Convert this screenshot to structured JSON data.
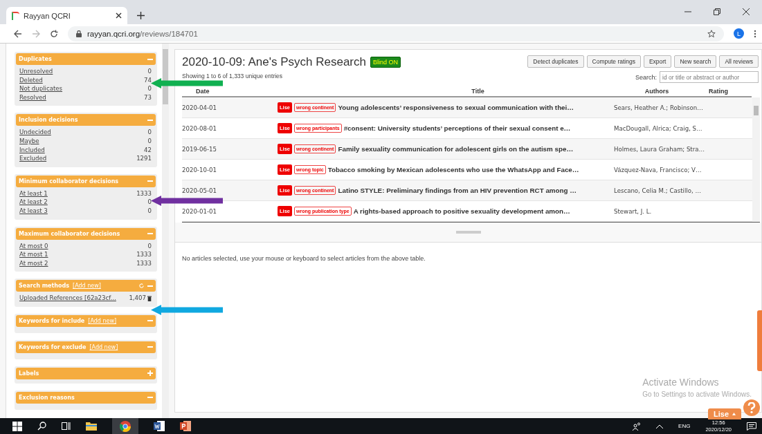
{
  "browser": {
    "tab_title": "Rayyan QCRI",
    "url_host": "rayyan.qcri.org",
    "url_path": "/reviews/184701",
    "profile": "L"
  },
  "sidebar": {
    "panels": [
      {
        "title": "Duplicates",
        "refreshable": false,
        "expanded": true,
        "items": [
          {
            "kind": "filter",
            "label": "Unresolved",
            "count": "0"
          },
          {
            "kind": "filter",
            "label": "Deleted",
            "count": "74"
          },
          {
            "kind": "filter",
            "label": "Not duplicates",
            "count": "0"
          },
          {
            "kind": "filter",
            "label": "Resolved",
            "count": "73"
          }
        ]
      },
      {
        "title": "Inclusion decisions",
        "refreshable": false,
        "expanded": true,
        "items": [
          {
            "kind": "filter",
            "label": "Undecided",
            "count": "0"
          },
          {
            "kind": "filter",
            "label": "Maybe",
            "count": "0"
          },
          {
            "kind": "filter",
            "label": "Included",
            "count": "42"
          },
          {
            "kind": "filter",
            "label": "Excluded",
            "count": "1291"
          }
        ]
      },
      {
        "title": "Minimum collaborator decisions",
        "refreshable": false,
        "expanded": true,
        "items": [
          {
            "kind": "filter",
            "label": "At least 1",
            "count": "1333"
          },
          {
            "kind": "filter",
            "label": "At least 2",
            "count": "0"
          },
          {
            "kind": "filter",
            "label": "At least 3",
            "count": "0"
          }
        ]
      },
      {
        "title": "Maximum collaborator decisions",
        "refreshable": false,
        "expanded": true,
        "items": [
          {
            "kind": "filter",
            "label": "At most 0",
            "count": "0"
          },
          {
            "kind": "filter",
            "label": "At most 1",
            "count": "1333"
          },
          {
            "kind": "filter",
            "label": "At most 2",
            "count": "1333"
          }
        ]
      },
      {
        "title": "Search methods",
        "add_link": "[Add new]",
        "refreshable": true,
        "expanded": true,
        "items": [
          {
            "kind": "source",
            "label": "Uploaded References [62a23cf...",
            "count": "1,407"
          }
        ]
      },
      {
        "title": "Keywords for include",
        "add_link": "[Add new]",
        "refreshable": false,
        "expanded": true
      },
      {
        "title": "Keywords for exclude",
        "add_link": "[Add new]",
        "refreshable": false,
        "expanded": true
      },
      {
        "title": "Labels",
        "refreshable": false,
        "expanded": false
      },
      {
        "title": "Exclusion reasons",
        "refreshable": false,
        "expanded": true
      }
    ]
  },
  "review": {
    "title": "2020-10-09: Ane's Psych Research",
    "blind_badge": "Blind ON",
    "info": "Showing 1 to 6 of 1,333 unique entries",
    "buttons": [
      "Detect duplicates",
      "Compute ratings",
      "Export",
      "New search",
      "All reviews"
    ],
    "search_label": "Search:",
    "search": {
      "placeholder": "id or title or abstract or author"
    }
  },
  "table": {
    "columns": [
      "Date",
      "Title",
      "Authors",
      "Rating"
    ],
    "rows": [
      {
        "date": "2020-04-01",
        "reviewer": "Lise",
        "reason": "wrong continent",
        "title": "Young adolescents’ responsiveness to sexual communication with thei…",
        "authors": "Sears, Heather A.; Robinson…"
      },
      {
        "date": "2020-08-01",
        "reviewer": "Lise",
        "reason": "wrong participants",
        "title": "#consent: University students’ perceptions of their sexual consent e…",
        "authors": "MacDougall, Alrica; Craig, S…"
      },
      {
        "date": "2019-06-15",
        "reviewer": "Lise",
        "reason": "wrong continent",
        "title": "Family sexuality communication for adolescent girls on the autism spe…",
        "authors": "Holmes, Laura Graham; Stra…"
      },
      {
        "date": "2020-10-01",
        "reviewer": "Lise",
        "reason": "wrong topic",
        "title": "Tobacco smoking by Mexican adolescents who use the WhatsApp and Face…",
        "authors": "Vázquez-Nava, Francisco; V…"
      },
      {
        "date": "2020-05-01",
        "reviewer": "Lise",
        "reason": "wrong continent",
        "title": "Latino STYLE: Preliminary findings from an HIV prevention RCT among …",
        "authors": "Lescano, Celia M.; Castillo, …"
      },
      {
        "date": "2020-01-01",
        "reviewer": "Lise",
        "reason": "wrong publication type",
        "title": "A rights-based approach to positive sexuality development amon…",
        "authors": "Stewart, J. L."
      }
    ]
  },
  "detail_message": "No articles selected, use your mouse or keyboard to select articles from the above table.",
  "activation": {
    "title": "Activate Windows",
    "subtitle": "Go to Settings to activate Windows."
  },
  "user_button": "Lise",
  "annotations": [
    {
      "color": "#10b050"
    },
    {
      "color": "#7030a0"
    },
    {
      "color": "#10a8e0"
    }
  ],
  "taskbar": {
    "language": "ENG",
    "time": "12:56",
    "date": "2020/12/20"
  }
}
